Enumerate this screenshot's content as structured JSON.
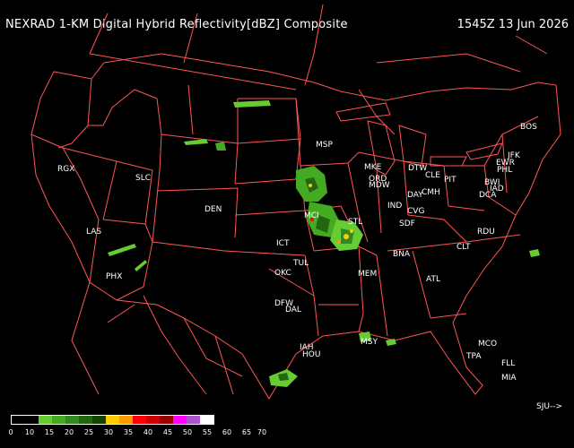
{
  "header": {
    "title": "NEXRAD 1-KM Digital Hybrid Reflectivity[dBZ] Composite",
    "timestamp": "1545Z 13 Jun 2026"
  },
  "map": {
    "border_color": "#ff5555",
    "cities": [
      {
        "code": "BOS"
      },
      {
        "code": "JFK"
      },
      {
        "code": "EWR"
      },
      {
        "code": "PHL"
      },
      {
        "code": "BWI"
      },
      {
        "code": "IAD"
      },
      {
        "code": "DCA"
      },
      {
        "code": "PIT"
      },
      {
        "code": "CLE"
      },
      {
        "code": "DTW"
      },
      {
        "code": "CMH"
      },
      {
        "code": "DAY"
      },
      {
        "code": "CVG"
      },
      {
        "code": "SDF"
      },
      {
        "code": "IND"
      },
      {
        "code": "ORD"
      },
      {
        "code": "MDW"
      },
      {
        "code": "MKE"
      },
      {
        "code": "MSP"
      },
      {
        "code": "STL"
      },
      {
        "code": "MCI"
      },
      {
        "code": "ICT"
      },
      {
        "code": "TUL"
      },
      {
        "code": "OKC"
      },
      {
        "code": "DFW"
      },
      {
        "code": "DAL"
      },
      {
        "code": "IAH"
      },
      {
        "code": "HOU"
      },
      {
        "code": "MSY"
      },
      {
        "code": "MEM"
      },
      {
        "code": "BNA"
      },
      {
        "code": "ATL"
      },
      {
        "code": "CLT"
      },
      {
        "code": "RDU"
      },
      {
        "code": "MCO"
      },
      {
        "code": "TPA"
      },
      {
        "code": "FLL"
      },
      {
        "code": "MIA"
      },
      {
        "code": "DEN"
      },
      {
        "code": "SLC"
      },
      {
        "code": "LAS"
      },
      {
        "code": "PHX"
      },
      {
        "code": "RGX"
      }
    ]
  },
  "legend": {
    "ticks": [
      "0",
      "10",
      "15",
      "20",
      "25",
      "30",
      "35",
      "40",
      "45",
      "50",
      "55",
      "60",
      "65",
      "70"
    ],
    "colors": [
      "#000000",
      "#000000",
      "#66cc33",
      "#44aa22",
      "#338822",
      "#226611",
      "#114400",
      "#ffcc00",
      "#ff9900",
      "#ff0000",
      "#cc0000",
      "#990000",
      "#ff00ff",
      "#aa55cc",
      "#ffffff"
    ],
    "nav_label": "SJU-->"
  }
}
